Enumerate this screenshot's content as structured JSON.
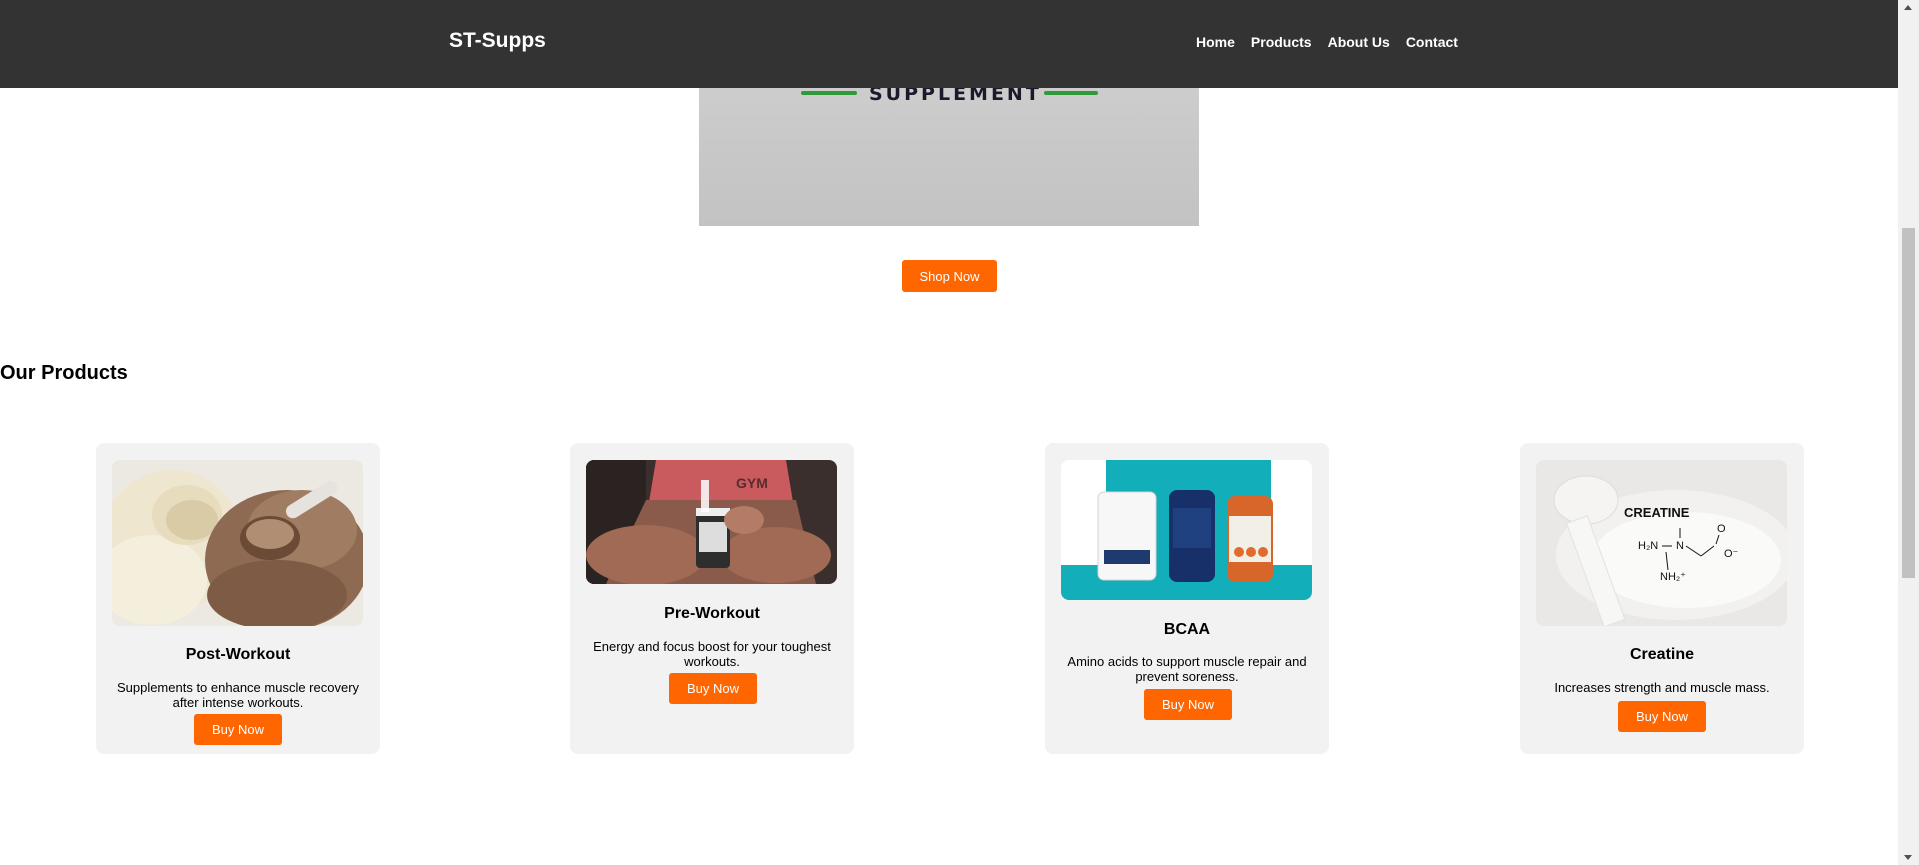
{
  "header": {
    "brand": "ST-Supps",
    "nav": [
      "Home",
      "Products",
      "About Us",
      "Contact"
    ]
  },
  "hero": {
    "image_text": "SUPPLEMENT",
    "button_label": "Shop Now"
  },
  "products_section": {
    "title": "Our Products",
    "items": [
      {
        "name": "Post-Workout",
        "description": "Supplements to enhance muscle recovery after intense workouts.",
        "button_label": "Buy Now",
        "image": "protein-powder-scoops-image"
      },
      {
        "name": "Pre-Workout",
        "description": "Energy and focus boost for your toughest workouts.",
        "button_label": "Buy Now",
        "image": "pre-workout-athlete-image"
      },
      {
        "name": "BCAA",
        "description": "Amino acids to support muscle repair and prevent soreness.",
        "button_label": "Buy Now",
        "image": "bcaa-bottles-image"
      },
      {
        "name": "Creatine",
        "description": "Increases strength and muscle mass.",
        "button_label": "Buy Now",
        "image": "creatine-powder-image",
        "image_text": "CREATINE"
      }
    ]
  },
  "colors": {
    "header_bg": "#333333",
    "accent": "#ff6600",
    "card_bg": "#f2f2f2"
  }
}
